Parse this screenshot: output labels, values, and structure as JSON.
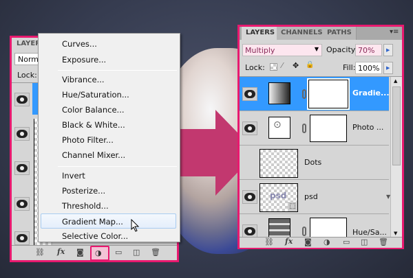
{
  "left_panel": {
    "tab": "LAYER",
    "blend": "Norma",
    "lock": "Lock:"
  },
  "menu": {
    "items": [
      "Curves...",
      "Exposure...",
      "Vibrance...",
      "Hue/Saturation...",
      "Color Balance...",
      "Black & White...",
      "Photo Filter...",
      "Channel Mixer...",
      "Invert",
      "Posterize...",
      "Threshold...",
      "Gradient Map...",
      "Selective Color..."
    ],
    "highlighted": "Gradient Map..."
  },
  "right_panel": {
    "tabs": [
      "LAYERS",
      "CHANNELS",
      "PATHS"
    ],
    "blend_mode": "Multiply",
    "opacity_label": "Opacity:",
    "opacity": "70%",
    "lock_label": "Lock:",
    "fill_label": "Fill:",
    "fill": "100%",
    "layers": [
      {
        "name": "Gradie...",
        "selected": true
      },
      {
        "name": "Photo ..."
      },
      {
        "name": "Dots"
      },
      {
        "name": "psd",
        "thumb_text": "psd"
      },
      {
        "name": "Hue/Sa..."
      }
    ]
  },
  "toolbar": {
    "fx": "fx"
  },
  "colors": {
    "accent": "#e8196f",
    "selected": "#3399ff"
  }
}
